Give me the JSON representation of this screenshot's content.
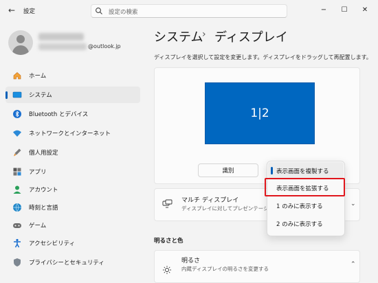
{
  "app": {
    "title": "設定",
    "search_placeholder": "設定の検索",
    "back_icon": "back-arrow-icon"
  },
  "window_controls": {
    "minimize": "−",
    "maximize": "☐",
    "close": "✕"
  },
  "user": {
    "email_suffix": "@outlook.jp"
  },
  "sidebar": {
    "selected_index": 1,
    "items": [
      {
        "label": "ホーム",
        "icon": "home-icon"
      },
      {
        "label": "システム",
        "icon": "system-display-icon"
      },
      {
        "label": "Bluetooth とデバイス",
        "icon": "bluetooth-icon"
      },
      {
        "label": "ネットワークとインターネット",
        "icon": "wifi-icon"
      },
      {
        "label": "個人用設定",
        "icon": "brush-icon"
      },
      {
        "label": "アプリ",
        "icon": "apps-icon"
      },
      {
        "label": "アカウント",
        "icon": "person-icon"
      },
      {
        "label": "時刻と言語",
        "icon": "globe-clock-icon"
      },
      {
        "label": "ゲーム",
        "icon": "gamepad-icon"
      },
      {
        "label": "アクセシビリティ",
        "icon": "accessibility-icon"
      },
      {
        "label": "プライバシーとセキュリティ",
        "icon": "shield-icon"
      }
    ]
  },
  "header": {
    "breadcrumb_parent": "システム",
    "breadcrumb_sep": "›",
    "breadcrumb_current": "ディスプレイ"
  },
  "arrangement": {
    "description": "ディスプレイを選択して設定を変更します。ディスプレイをドラッグして再配置します。",
    "monitor_label": "1|2",
    "identify_label": "識別"
  },
  "dropdown": {
    "selected_index": 0,
    "highlighted_index": 1,
    "options": [
      "表示画面を複製する",
      "表示画面を拡張する",
      "1 のみに表示する",
      "2 のみに表示する"
    ]
  },
  "multi_display": {
    "title": "マルチ ディスプレイ",
    "subtitle": "ディスプレイに対してプレゼンテーション モー"
  },
  "brightness_section": {
    "heading": "明るさと色",
    "title": "明るさ",
    "subtitle": "内蔵ディスプレイの明るさを変更する"
  },
  "colors": {
    "accent": "#005fb8",
    "monitor_fill": "#0067c0",
    "highlight_border": "#e0151b"
  }
}
